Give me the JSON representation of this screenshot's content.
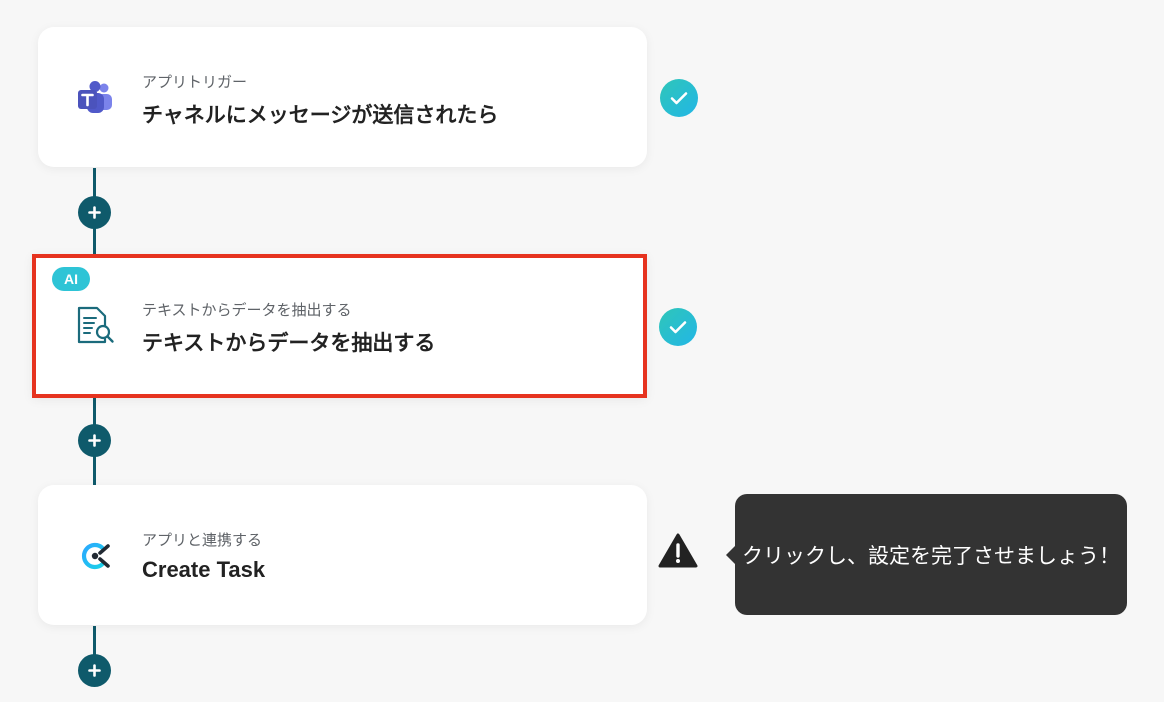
{
  "flow": {
    "steps": [
      {
        "subtitle": "アプリトリガー",
        "title": "チャネルにメッセージが送信されたら",
        "icon": "microsoft-teams-icon",
        "status": "complete",
        "selected": false
      },
      {
        "badge": "AI",
        "subtitle": "テキストからデータを抽出する",
        "title": "テキストからデータを抽出する",
        "icon": "document-search-icon",
        "status": "complete",
        "selected": true
      },
      {
        "subtitle": "アプリと連携する",
        "title": "Create Task",
        "icon": "clickup-icon",
        "status": "warning",
        "selected": false
      }
    ],
    "add_step_icon": "plus-icon"
  },
  "tooltip": {
    "text": "クリックし、設定を完了させましょう！"
  },
  "colors": {
    "connector": "#0f5a6b",
    "selected_border": "#e6331f",
    "check": "#22b6e6",
    "warning": "#222222",
    "tooltip_bg": "#333333",
    "ai_badge": "#2ec4d6"
  }
}
